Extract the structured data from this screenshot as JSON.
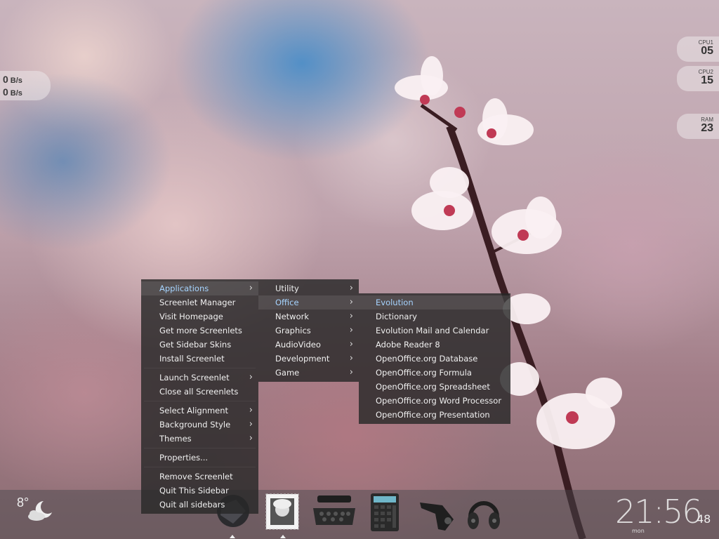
{
  "network": {
    "down": "0",
    "up": "0",
    "unit": "B/s"
  },
  "cpu1": {
    "label": "CPU1",
    "value": "05"
  },
  "cpu2": {
    "label": "CPU2",
    "value": "15"
  },
  "ram": {
    "label": "RAM",
    "value": "23"
  },
  "main_menu": {
    "items": [
      {
        "label": "Applications",
        "submenu": true,
        "highlighted": true
      },
      {
        "label": "Screenlet Manager"
      },
      {
        "label": "Visit Homepage"
      },
      {
        "label": "Get more Screenlets"
      },
      {
        "label": "Get Sidebar Skins"
      },
      {
        "label": "Install Screenlet"
      },
      {
        "label": "Launch Screenlet",
        "submenu": true
      },
      {
        "label": "Close all Screenlets"
      },
      {
        "label": "Select Alignment",
        "submenu": true
      },
      {
        "label": "Background Style",
        "submenu": true
      },
      {
        "label": "Themes",
        "submenu": true
      },
      {
        "label": "Properties..."
      },
      {
        "label": "Remove Screenlet"
      },
      {
        "label": "Quit This Sidebar"
      },
      {
        "label": "Quit all sidebars"
      }
    ]
  },
  "categories_menu": {
    "items": [
      {
        "label": "Utility"
      },
      {
        "label": "Office",
        "highlighted": true
      },
      {
        "label": "Network"
      },
      {
        "label": "Graphics"
      },
      {
        "label": "AudioVideo"
      },
      {
        "label": "Development"
      },
      {
        "label": "Game"
      }
    ]
  },
  "office_menu": {
    "items": [
      {
        "label": "Evolution",
        "highlighted": true
      },
      {
        "label": "Dictionary"
      },
      {
        "label": "Evolution Mail and Calendar"
      },
      {
        "label": "Adobe Reader 8"
      },
      {
        "label": "OpenOffice.org Database"
      },
      {
        "label": "OpenOffice.org Formula"
      },
      {
        "label": "OpenOffice.org Spreadsheet"
      },
      {
        "label": "OpenOffice.org Word Processor"
      },
      {
        "label": "OpenOffice.org Presentation"
      }
    ]
  },
  "weather": {
    "temperature": "8°",
    "icon": "moon-cloud-icon"
  },
  "clock": {
    "time": "21:56",
    "seconds": "48",
    "day": "mon"
  },
  "dock": {
    "icons": [
      "globe-icon",
      "einstein-stamp-icon",
      "typewriter-icon",
      "calculator-icon",
      "stapler-icon",
      "headphones-icon"
    ]
  },
  "colors": {
    "highlight_text": "#a6d4ff",
    "menu_bg": "#282828"
  }
}
